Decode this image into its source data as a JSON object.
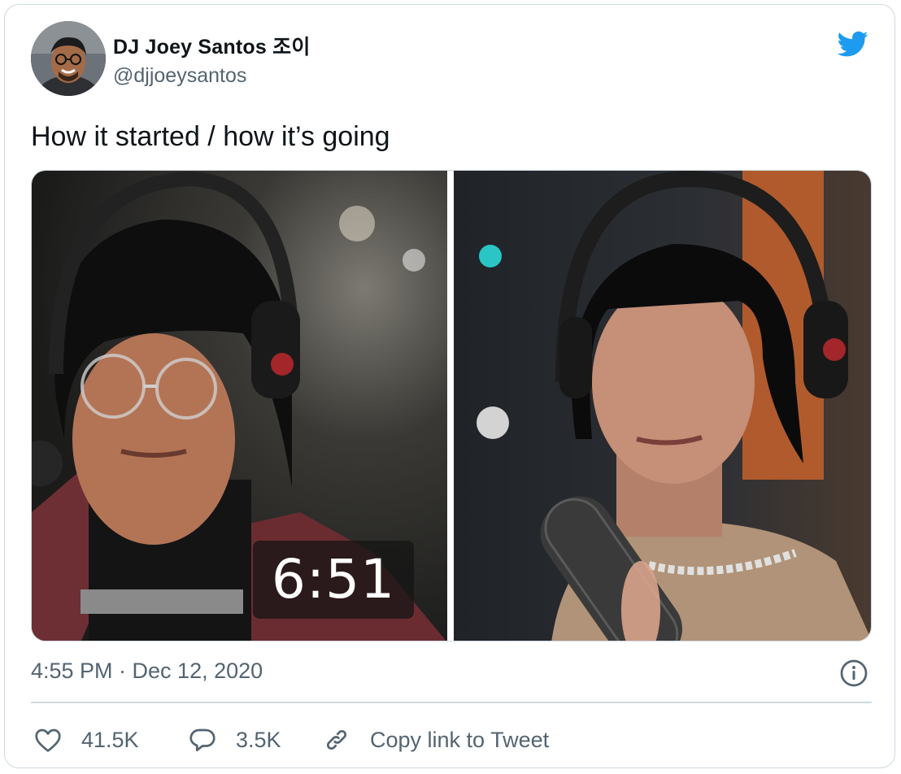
{
  "author": {
    "display_name": "DJ Joey Santos 조이",
    "handle": "@djjoeysantos"
  },
  "tweet": {
    "text": "How it started / how it’s going",
    "media_left_overlay": "6:51",
    "timestamp": "4:55 PM · Dec 12, 2020"
  },
  "actions": {
    "likes": "41.5K",
    "replies": "3.5K",
    "copy_link": "Copy link to Tweet"
  },
  "colors": {
    "brand": "#1d9bf0",
    "secondary_text": "#536471",
    "border": "#cfd9de"
  },
  "icons": [
    "twitter-bird-icon",
    "info-icon",
    "heart-icon",
    "reply-bubble-icon",
    "link-icon"
  ]
}
